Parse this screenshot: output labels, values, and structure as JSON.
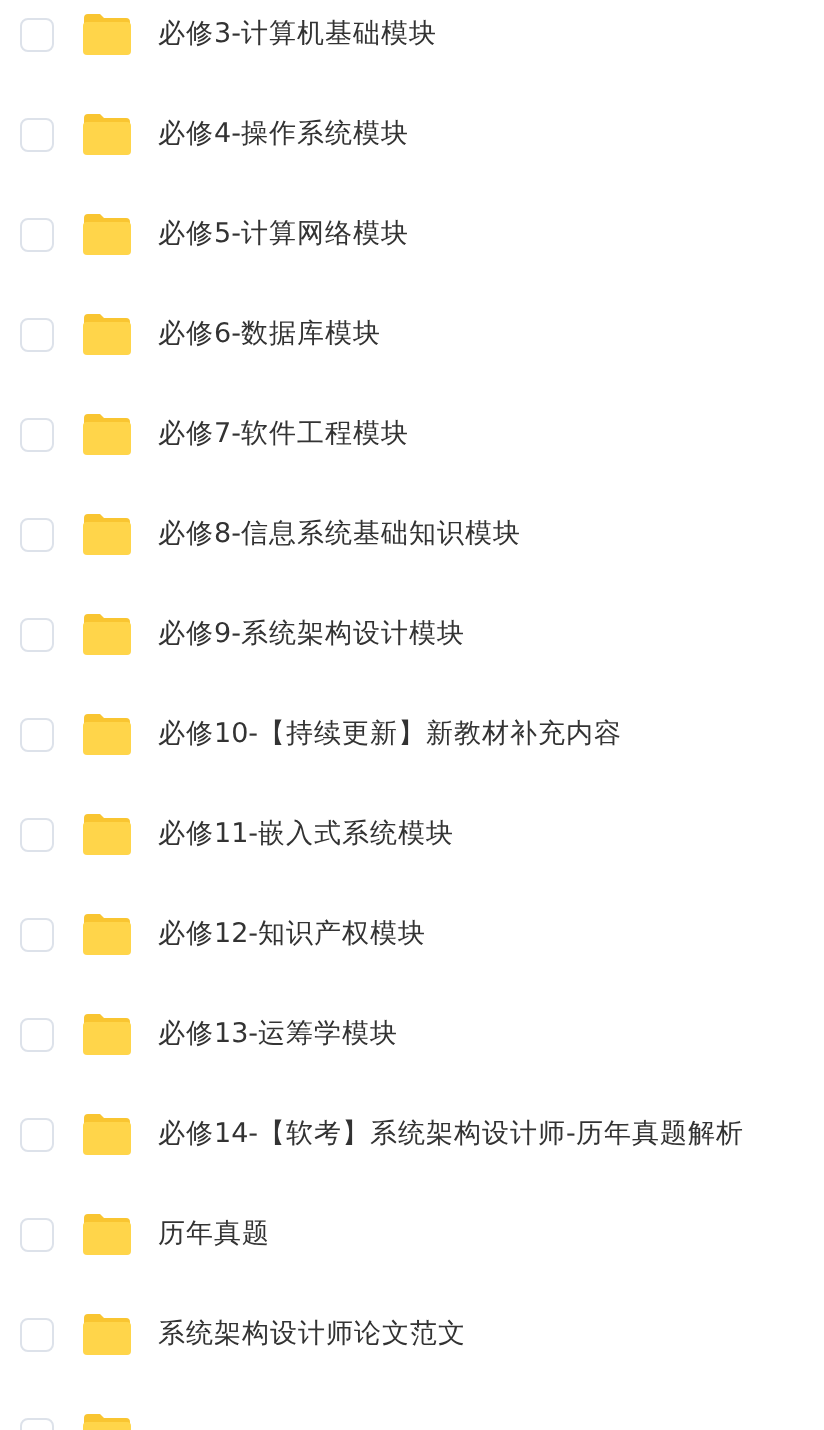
{
  "files": [
    {
      "name": "必修3-计算机基础模块",
      "checked": false
    },
    {
      "name": "必修4-操作系统模块",
      "checked": false
    },
    {
      "name": "必修5-计算网络模块",
      "checked": false
    },
    {
      "name": "必修6-数据库模块",
      "checked": false
    },
    {
      "name": "必修7-软件工程模块",
      "checked": false
    },
    {
      "name": "必修8-信息系统基础知识模块",
      "checked": false
    },
    {
      "name": "必修9-系统架构设计模块",
      "checked": false
    },
    {
      "name": "必修10-【持续更新】新教材补充内容",
      "checked": false
    },
    {
      "name": "必修11-嵌入式系统模块",
      "checked": false
    },
    {
      "name": "必修12-知识产权模块",
      "checked": false
    },
    {
      "name": "必修13-运筹学模块",
      "checked": false
    },
    {
      "name": "必修14-【软考】系统架构设计师-历年真题解析",
      "checked": false
    },
    {
      "name": "历年真题",
      "checked": false
    },
    {
      "name": "系统架构设计师论文范文",
      "checked": false
    },
    {
      "checked": false
    }
  ]
}
